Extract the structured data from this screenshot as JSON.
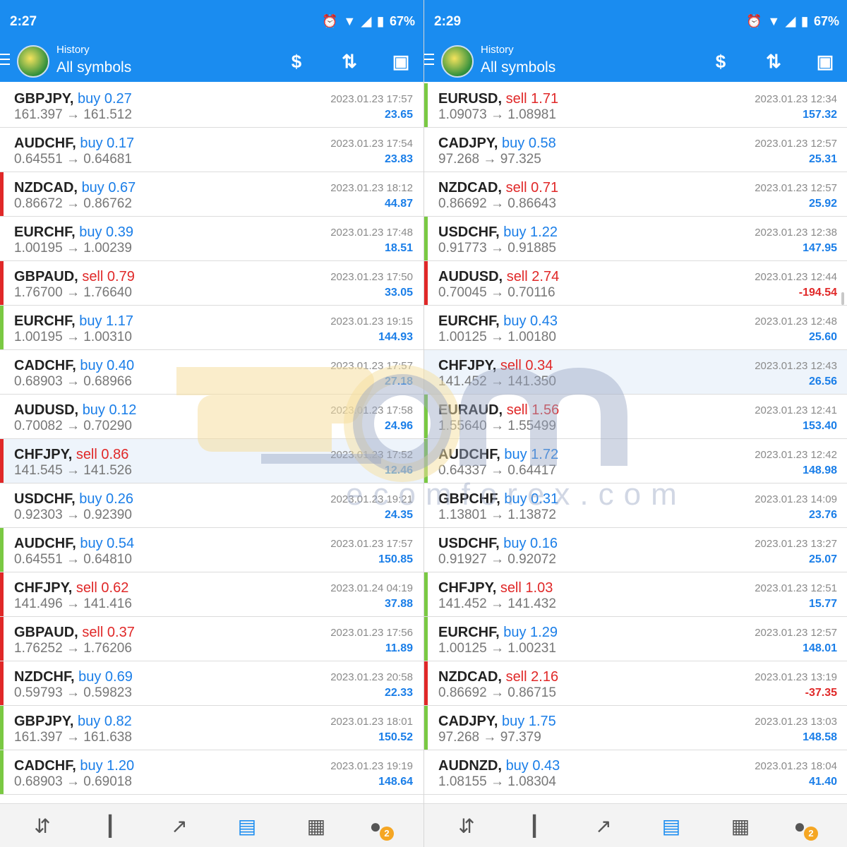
{
  "app": {
    "title_small": "History",
    "title_big": "All symbols"
  },
  "colors": {
    "accent": "#1a8cf0",
    "buy": "#1a7ee8",
    "sell": "#e02828",
    "bar_green": "#7ac943",
    "bar_red": "#e02828"
  },
  "watermark": {
    "text": "ecomforex.com"
  },
  "left": {
    "status": {
      "time": "2:27",
      "battery": "67%"
    },
    "trades": [
      {
        "symbol": "GBPJPY,",
        "side": "buy",
        "vol": "0.27",
        "open": "161.397",
        "close": "161.512",
        "time": "2023.01.23 17:57",
        "profit": "23.65",
        "bar": "none",
        "hl": false
      },
      {
        "symbol": "AUDCHF,",
        "side": "buy",
        "vol": "0.17",
        "open": "0.64551",
        "close": "0.64681",
        "time": "2023.01.23 17:54",
        "profit": "23.83",
        "bar": "none",
        "hl": false
      },
      {
        "symbol": "NZDCAD,",
        "side": "buy",
        "vol": "0.67",
        "open": "0.86672",
        "close": "0.86762",
        "time": "2023.01.23 18:12",
        "profit": "44.87",
        "bar": "red",
        "hl": false
      },
      {
        "symbol": "EURCHF,",
        "side": "buy",
        "vol": "0.39",
        "open": "1.00195",
        "close": "1.00239",
        "time": "2023.01.23 17:48",
        "profit": "18.51",
        "bar": "none",
        "hl": false
      },
      {
        "symbol": "GBPAUD,",
        "side": "sell",
        "vol": "0.79",
        "open": "1.76700",
        "close": "1.76640",
        "time": "2023.01.23 17:50",
        "profit": "33.05",
        "bar": "red",
        "hl": false
      },
      {
        "symbol": "EURCHF,",
        "side": "buy",
        "vol": "1.17",
        "open": "1.00195",
        "close": "1.00310",
        "time": "2023.01.23 19:15",
        "profit": "144.93",
        "bar": "green",
        "hl": false
      },
      {
        "symbol": "CADCHF,",
        "side": "buy",
        "vol": "0.40",
        "open": "0.68903",
        "close": "0.68966",
        "time": "2023.01.23 17:57",
        "profit": "27.18",
        "bar": "none",
        "hl": false
      },
      {
        "symbol": "AUDUSD,",
        "side": "buy",
        "vol": "0.12",
        "open": "0.70082",
        "close": "0.70290",
        "time": "2023.01.23 17:58",
        "profit": "24.96",
        "bar": "none",
        "hl": false
      },
      {
        "symbol": "CHFJPY,",
        "side": "sell",
        "vol": "0.86",
        "open": "141.545",
        "close": "141.526",
        "time": "2023.01.23 17:52",
        "profit": "12.46",
        "bar": "red",
        "hl": true
      },
      {
        "symbol": "USDCHF,",
        "side": "buy",
        "vol": "0.26",
        "open": "0.92303",
        "close": "0.92390",
        "time": "2023.01.23 19:21",
        "profit": "24.35",
        "bar": "none",
        "hl": false
      },
      {
        "symbol": "AUDCHF,",
        "side": "buy",
        "vol": "0.54",
        "open": "0.64551",
        "close": "0.64810",
        "time": "2023.01.23 17:57",
        "profit": "150.85",
        "bar": "green",
        "hl": false
      },
      {
        "symbol": "CHFJPY,",
        "side": "sell",
        "vol": "0.62",
        "open": "141.496",
        "close": "141.416",
        "time": "2023.01.24 04:19",
        "profit": "37.88",
        "bar": "red",
        "hl": false
      },
      {
        "symbol": "GBPAUD,",
        "side": "sell",
        "vol": "0.37",
        "open": "1.76252",
        "close": "1.76206",
        "time": "2023.01.23 17:56",
        "profit": "11.89",
        "bar": "red",
        "hl": false
      },
      {
        "symbol": "NZDCHF,",
        "side": "buy",
        "vol": "0.69",
        "open": "0.59793",
        "close": "0.59823",
        "time": "2023.01.23 20:58",
        "profit": "22.33",
        "bar": "red",
        "hl": false
      },
      {
        "symbol": "GBPJPY,",
        "side": "buy",
        "vol": "0.82",
        "open": "161.397",
        "close": "161.638",
        "time": "2023.01.23 18:01",
        "profit": "150.52",
        "bar": "green",
        "hl": false
      },
      {
        "symbol": "CADCHF,",
        "side": "buy",
        "vol": "1.20",
        "open": "0.68903",
        "close": "0.69018",
        "time": "2023.01.23 19:19",
        "profit": "148.64",
        "bar": "green",
        "hl": false
      }
    ]
  },
  "right": {
    "status": {
      "time": "2:29",
      "battery": "67%"
    },
    "trades": [
      {
        "symbol": "EURUSD,",
        "side": "sell",
        "vol": "1.71",
        "open": "1.09073",
        "close": "1.08981",
        "time": "2023.01.23 12:34",
        "profit": "157.32",
        "bar": "green",
        "hl": false
      },
      {
        "symbol": "CADJPY,",
        "side": "buy",
        "vol": "0.58",
        "open": "97.268",
        "close": "97.325",
        "time": "2023.01.23 12:57",
        "profit": "25.31",
        "bar": "none",
        "hl": false
      },
      {
        "symbol": "NZDCAD,",
        "side": "sell",
        "vol": "0.71",
        "open": "0.86692",
        "close": "0.86643",
        "time": "2023.01.23 12:57",
        "profit": "25.92",
        "bar": "none",
        "hl": false
      },
      {
        "symbol": "USDCHF,",
        "side": "buy",
        "vol": "1.22",
        "open": "0.91773",
        "close": "0.91885",
        "time": "2023.01.23 12:38",
        "profit": "147.95",
        "bar": "green",
        "hl": false
      },
      {
        "symbol": "AUDUSD,",
        "side": "sell",
        "vol": "2.74",
        "open": "0.70045",
        "close": "0.70116",
        "time": "2023.01.23 12:44",
        "profit": "-194.54",
        "bar": "red",
        "hl": false
      },
      {
        "symbol": "EURCHF,",
        "side": "buy",
        "vol": "0.43",
        "open": "1.00125",
        "close": "1.00180",
        "time": "2023.01.23 12:48",
        "profit": "25.60",
        "bar": "none",
        "hl": false
      },
      {
        "symbol": "CHFJPY,",
        "side": "sell",
        "vol": "0.34",
        "open": "141.452",
        "close": "141.350",
        "time": "2023.01.23 12:43",
        "profit": "26.56",
        "bar": "none",
        "hl": true
      },
      {
        "symbol": "EURAUD,",
        "side": "sell",
        "vol": "1.56",
        "open": "1.55640",
        "close": "1.55499",
        "time": "2023.01.23 12:41",
        "profit": "153.40",
        "bar": "green",
        "hl": false
      },
      {
        "symbol": "AUDCHF,",
        "side": "buy",
        "vol": "1.72",
        "open": "0.64337",
        "close": "0.64417",
        "time": "2023.01.23 12:42",
        "profit": "148.98",
        "bar": "green",
        "hl": false
      },
      {
        "symbol": "GBPCHF,",
        "side": "buy",
        "vol": "0.31",
        "open": "1.13801",
        "close": "1.13872",
        "time": "2023.01.23 14:09",
        "profit": "23.76",
        "bar": "none",
        "hl": false
      },
      {
        "symbol": "USDCHF,",
        "side": "buy",
        "vol": "0.16",
        "open": "0.91927",
        "close": "0.92072",
        "time": "2023.01.23 13:27",
        "profit": "25.07",
        "bar": "none",
        "hl": false
      },
      {
        "symbol": "CHFJPY,",
        "side": "sell",
        "vol": "1.03",
        "open": "141.452",
        "close": "141.432",
        "time": "2023.01.23 12:51",
        "profit": "15.77",
        "bar": "green",
        "hl": false
      },
      {
        "symbol": "EURCHF,",
        "side": "buy",
        "vol": "1.29",
        "open": "1.00125",
        "close": "1.00231",
        "time": "2023.01.23 12:57",
        "profit": "148.01",
        "bar": "green",
        "hl": false
      },
      {
        "symbol": "NZDCAD,",
        "side": "sell",
        "vol": "2.16",
        "open": "0.86692",
        "close": "0.86715",
        "time": "2023.01.23 13:19",
        "profit": "-37.35",
        "bar": "red",
        "hl": false
      },
      {
        "symbol": "CADJPY,",
        "side": "buy",
        "vol": "1.75",
        "open": "97.268",
        "close": "97.379",
        "time": "2023.01.23 13:03",
        "profit": "148.58",
        "bar": "green",
        "hl": false
      },
      {
        "symbol": "AUDNZD,",
        "side": "buy",
        "vol": "0.43",
        "open": "1.08155",
        "close": "1.08304",
        "time": "2023.01.23 18:04",
        "profit": "41.40",
        "bar": "none",
        "hl": false
      }
    ]
  },
  "nav": {
    "items": [
      "quotes-icon",
      "chart-icon",
      "trade-icon",
      "history-icon",
      "news-icon",
      "chat-icon"
    ],
    "chat_badge": "2"
  }
}
